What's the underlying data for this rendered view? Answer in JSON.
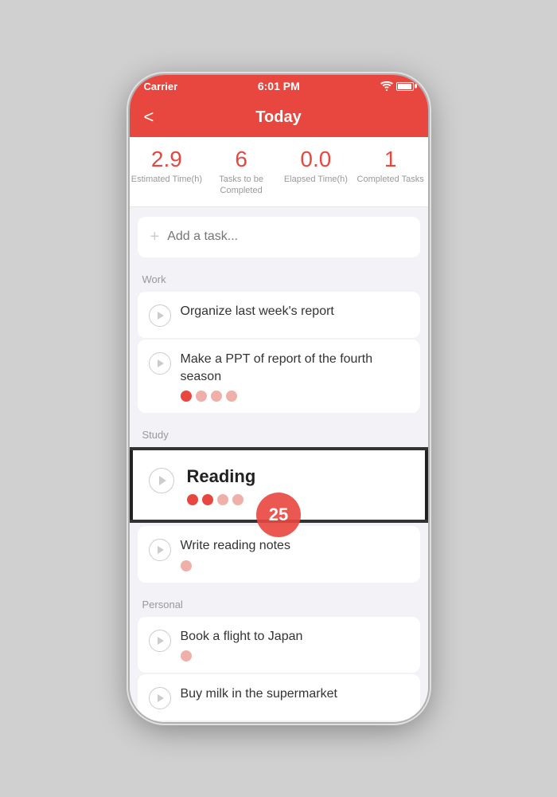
{
  "statusBar": {
    "carrier": "Carrier",
    "time": "6:01 PM"
  },
  "header": {
    "title": "Today",
    "backLabel": "<"
  },
  "stats": [
    {
      "id": "estimated-time",
      "value": "2.9",
      "label": "Estimated Time(h)"
    },
    {
      "id": "tasks-to-complete",
      "value": "6",
      "label": "Tasks to be Completed"
    },
    {
      "id": "elapsed-time",
      "value": "0.0",
      "label": "Elapsed Time(h)"
    },
    {
      "id": "completed-tasks",
      "value": "1",
      "label": "Completed Tasks"
    }
  ],
  "addTask": {
    "placeholder": "Add a task..."
  },
  "sections": [
    {
      "id": "work",
      "label": "Work",
      "tasks": [
        {
          "id": "task-organize",
          "title": "Organize last week's report",
          "dots": []
        },
        {
          "id": "task-ppt",
          "title": "Make a PPT of report of the fourth season",
          "dots": [
            {
              "filled": true
            },
            {
              "filled": false
            },
            {
              "filled": false
            },
            {
              "filled": false
            }
          ]
        }
      ]
    },
    {
      "id": "study",
      "label": "Study",
      "tasks": [
        {
          "id": "task-reading",
          "title": "Reading",
          "highlighted": true,
          "dots": [
            {
              "filled": true
            },
            {
              "filled": true
            },
            {
              "filled": false
            },
            {
              "filled": false
            }
          ]
        },
        {
          "id": "task-notes",
          "title": "Write reading notes",
          "dots": [
            {
              "filled": false
            }
          ]
        }
      ]
    },
    {
      "id": "personal",
      "label": "Personal",
      "tasks": [
        {
          "id": "task-flight",
          "title": "Book a flight to Japan",
          "dots": [
            {
              "filled": false
            }
          ]
        },
        {
          "id": "task-milk",
          "title": "Buy milk in the supermarket",
          "dots": []
        }
      ]
    }
  ],
  "floatingBadge": "25"
}
